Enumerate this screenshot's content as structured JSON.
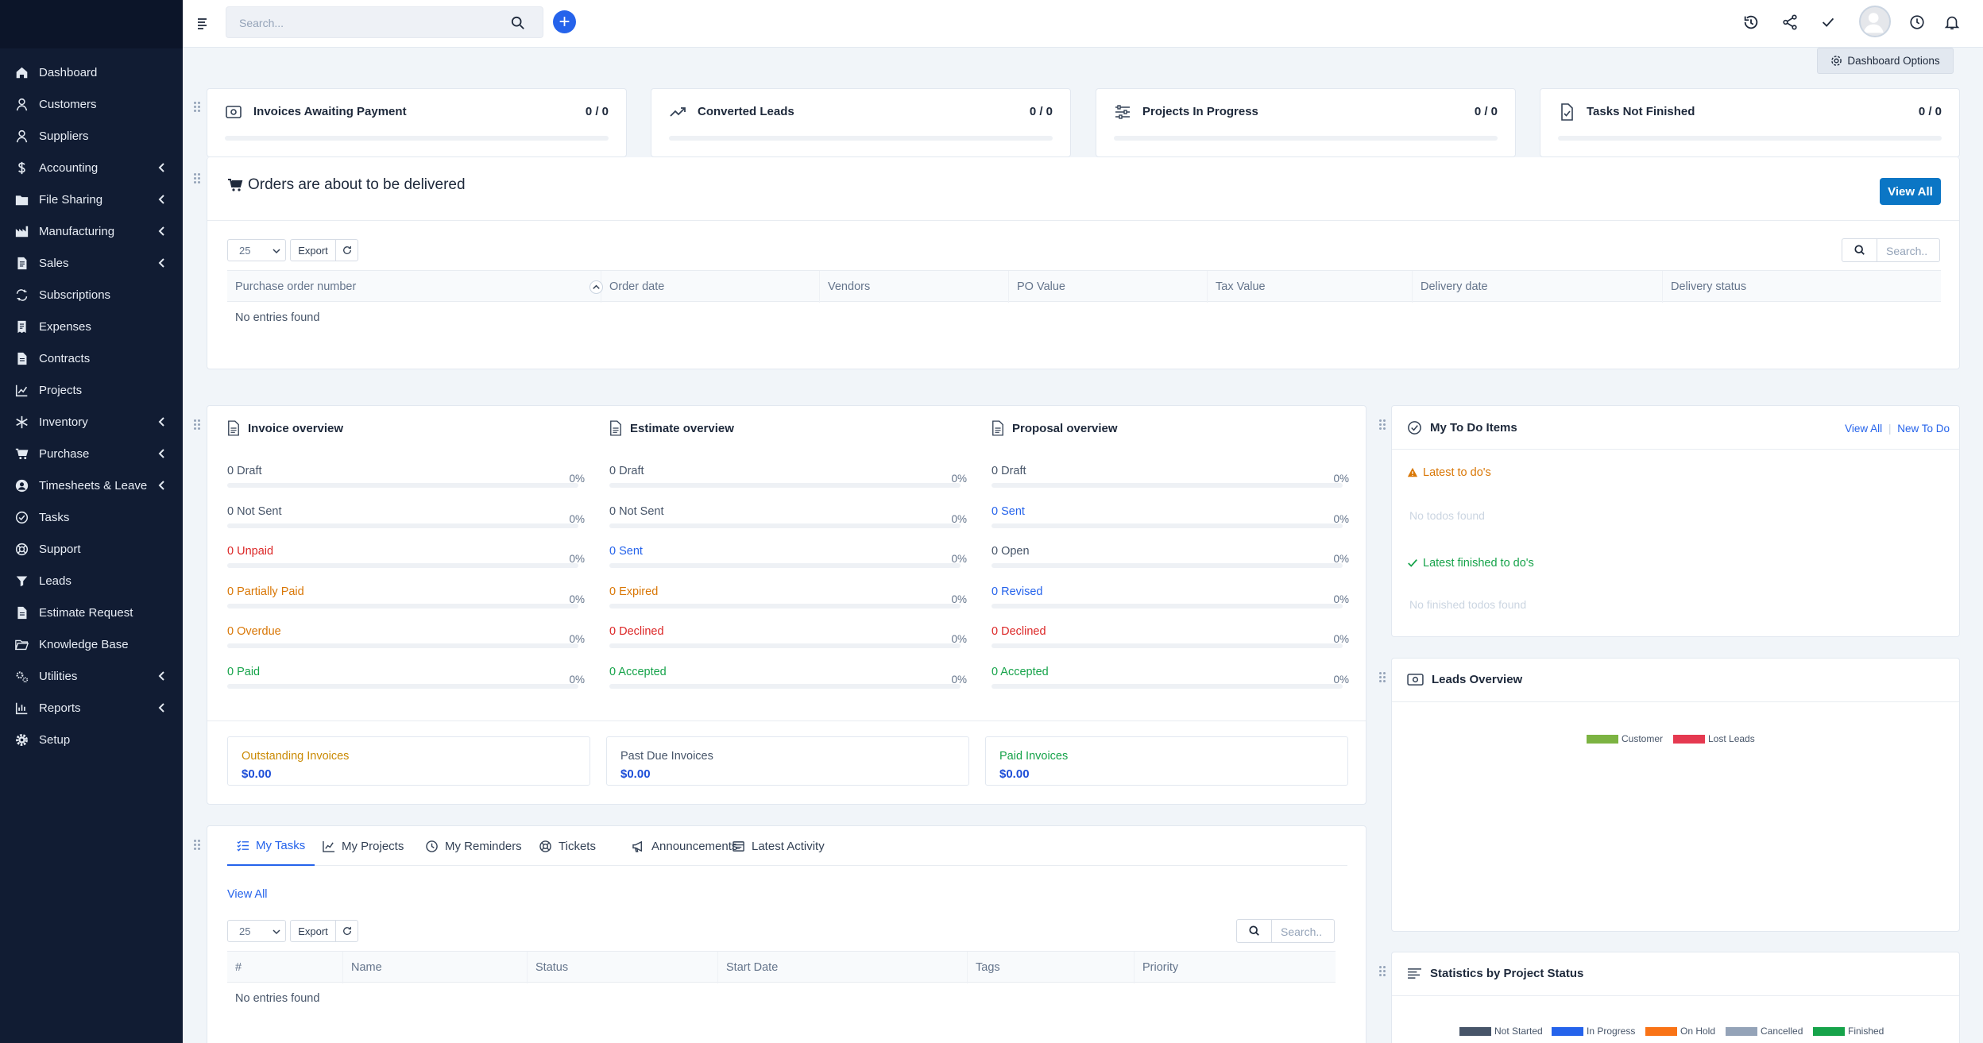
{
  "sidebar": {
    "items": [
      {
        "label": "Dashboard",
        "icon": "home-icon",
        "has_submenu": false
      },
      {
        "label": "Customers",
        "icon": "user-icon",
        "has_submenu": false
      },
      {
        "label": "Suppliers",
        "icon": "user-icon",
        "has_submenu": false
      },
      {
        "label": "Accounting",
        "icon": "dollar-icon",
        "has_submenu": true
      },
      {
        "label": "File Sharing",
        "icon": "folder-icon",
        "has_submenu": true
      },
      {
        "label": "Manufacturing",
        "icon": "factory-icon",
        "has_submenu": true
      },
      {
        "label": "Sales",
        "icon": "document-icon",
        "has_submenu": true
      },
      {
        "label": "Subscriptions",
        "icon": "repeat-icon",
        "has_submenu": false
      },
      {
        "label": "Expenses",
        "icon": "receipt-icon",
        "has_submenu": false
      },
      {
        "label": "Contracts",
        "icon": "file-icon",
        "has_submenu": false
      },
      {
        "label": "Projects",
        "icon": "chart-icon",
        "has_submenu": false
      },
      {
        "label": "Inventory",
        "icon": "snowflake-icon",
        "has_submenu": true
      },
      {
        "label": "Purchase",
        "icon": "cart-icon",
        "has_submenu": true
      },
      {
        "label": "Timesheets & Leave",
        "icon": "user-circle-icon",
        "has_submenu": true
      },
      {
        "label": "Tasks",
        "icon": "check-circle-icon",
        "has_submenu": false
      },
      {
        "label": "Support",
        "icon": "lifebuoy-icon",
        "has_submenu": false
      },
      {
        "label": "Leads",
        "icon": "funnel-icon",
        "has_submenu": false
      },
      {
        "label": "Estimate Request",
        "icon": "file-icon",
        "has_submenu": false
      },
      {
        "label": "Knowledge Base",
        "icon": "folder-open-icon",
        "has_submenu": false
      },
      {
        "label": "Utilities",
        "icon": "cogs-icon",
        "has_submenu": true
      },
      {
        "label": "Reports",
        "icon": "bar-chart-icon",
        "has_submenu": true
      },
      {
        "label": "Setup",
        "icon": "gear-icon",
        "has_submenu": false
      }
    ]
  },
  "topbar": {
    "search_placeholder": "Search...",
    "icons": [
      "history-icon",
      "share-icon",
      "check-icon",
      "avatar",
      "clock-icon",
      "bell-icon"
    ]
  },
  "dashboard_options": "Dashboard Options",
  "stats": [
    {
      "title": "Invoices Awaiting Payment",
      "value": "0 / 0",
      "icon": "money-icon"
    },
    {
      "title": "Converted Leads",
      "value": "0 / 0",
      "icon": "trend-icon"
    },
    {
      "title": "Projects In Progress",
      "value": "0 / 0",
      "icon": "sliders-icon"
    },
    {
      "title": "Tasks Not Finished",
      "value": "0 / 0",
      "icon": "file-check-icon"
    }
  ],
  "orders": {
    "title": "Orders are about to be delivered",
    "view_all": "View All",
    "page_size": "25",
    "export": "Export",
    "search_placeholder": "Search..",
    "columns": [
      "Purchase order number",
      "Order date",
      "Vendors",
      "PO Value",
      "Tax Value",
      "Delivery date",
      "Delivery status"
    ],
    "empty": "No entries found"
  },
  "invoice_overview": {
    "title": "Invoice overview",
    "rows": [
      {
        "label": "0 Draft",
        "pct": "0%",
        "color": "default"
      },
      {
        "label": "0 Not Sent",
        "pct": "0%",
        "color": "default"
      },
      {
        "label": "0 Unpaid",
        "pct": "0%",
        "color": "red"
      },
      {
        "label": "0 Partially Paid",
        "pct": "0%",
        "color": "orange"
      },
      {
        "label": "0 Overdue",
        "pct": "0%",
        "color": "orange"
      },
      {
        "label": "0 Paid",
        "pct": "0%",
        "color": "green"
      }
    ]
  },
  "estimate_overview": {
    "title": "Estimate overview",
    "rows": [
      {
        "label": "0 Draft",
        "pct": "0%",
        "color": "default"
      },
      {
        "label": "0 Not Sent",
        "pct": "0%",
        "color": "default"
      },
      {
        "label": "0 Sent",
        "pct": "0%",
        "color": "blue"
      },
      {
        "label": "0 Expired",
        "pct": "0%",
        "color": "orange"
      },
      {
        "label": "0 Declined",
        "pct": "0%",
        "color": "red"
      },
      {
        "label": "0 Accepted",
        "pct": "0%",
        "color": "green"
      }
    ]
  },
  "proposal_overview": {
    "title": "Proposal overview",
    "rows": [
      {
        "label": "0 Draft",
        "pct": "0%",
        "color": "default"
      },
      {
        "label": "0 Sent",
        "pct": "0%",
        "color": "blue"
      },
      {
        "label": "0 Open",
        "pct": "0%",
        "color": "default"
      },
      {
        "label": "0 Revised",
        "pct": "0%",
        "color": "blue"
      },
      {
        "label": "0 Declined",
        "pct": "0%",
        "color": "red"
      },
      {
        "label": "0 Accepted",
        "pct": "0%",
        "color": "green"
      }
    ]
  },
  "summary_boxes": [
    {
      "title": "Outstanding Invoices",
      "value": "$0.00",
      "color": "orange"
    },
    {
      "title": "Past Due Invoices",
      "value": "$0.00",
      "color": "default"
    },
    {
      "title": "Paid Invoices",
      "value": "$0.00",
      "color": "green"
    }
  ],
  "tabs": {
    "items": [
      {
        "label": "My Tasks",
        "icon": "tasks-icon",
        "active": true
      },
      {
        "label": "My Projects",
        "icon": "chart-icon",
        "active": false
      },
      {
        "label": "My Reminders",
        "icon": "clock-icon",
        "active": false
      },
      {
        "label": "Tickets",
        "icon": "lifebuoy-icon",
        "active": false
      },
      {
        "label": "Announcements",
        "icon": "megaphone-icon",
        "active": false
      },
      {
        "label": "Latest Activity",
        "icon": "window-icon",
        "active": false
      }
    ],
    "view_all": "View All",
    "page_size": "25",
    "export": "Export",
    "search_placeholder": "Search..",
    "columns": [
      "#",
      "Name",
      "Status",
      "Start Date",
      "Tags",
      "Priority"
    ],
    "empty": "No entries found"
  },
  "todo": {
    "title": "My To Do Items",
    "view_all": "View All",
    "new_todo": "New To Do",
    "latest_title": "Latest to do's",
    "latest_empty": "No todos found",
    "finished_title": "Latest finished to do's",
    "finished_empty": "No finished todos found"
  },
  "leads_overview": {
    "title": "Leads Overview",
    "legend": [
      {
        "label": "Customer",
        "color": "#7cb342"
      },
      {
        "label": "Lost Leads",
        "color": "#e53950"
      }
    ]
  },
  "project_stats": {
    "title": "Statistics by Project Status",
    "legend": [
      {
        "label": "Not Started",
        "color": "#475569"
      },
      {
        "label": "In Progress",
        "color": "#2563eb"
      },
      {
        "label": "On Hold",
        "color": "#f97316"
      },
      {
        "label": "Cancelled",
        "color": "#94a3b8"
      },
      {
        "label": "Finished",
        "color": "#16a34a"
      }
    ]
  }
}
